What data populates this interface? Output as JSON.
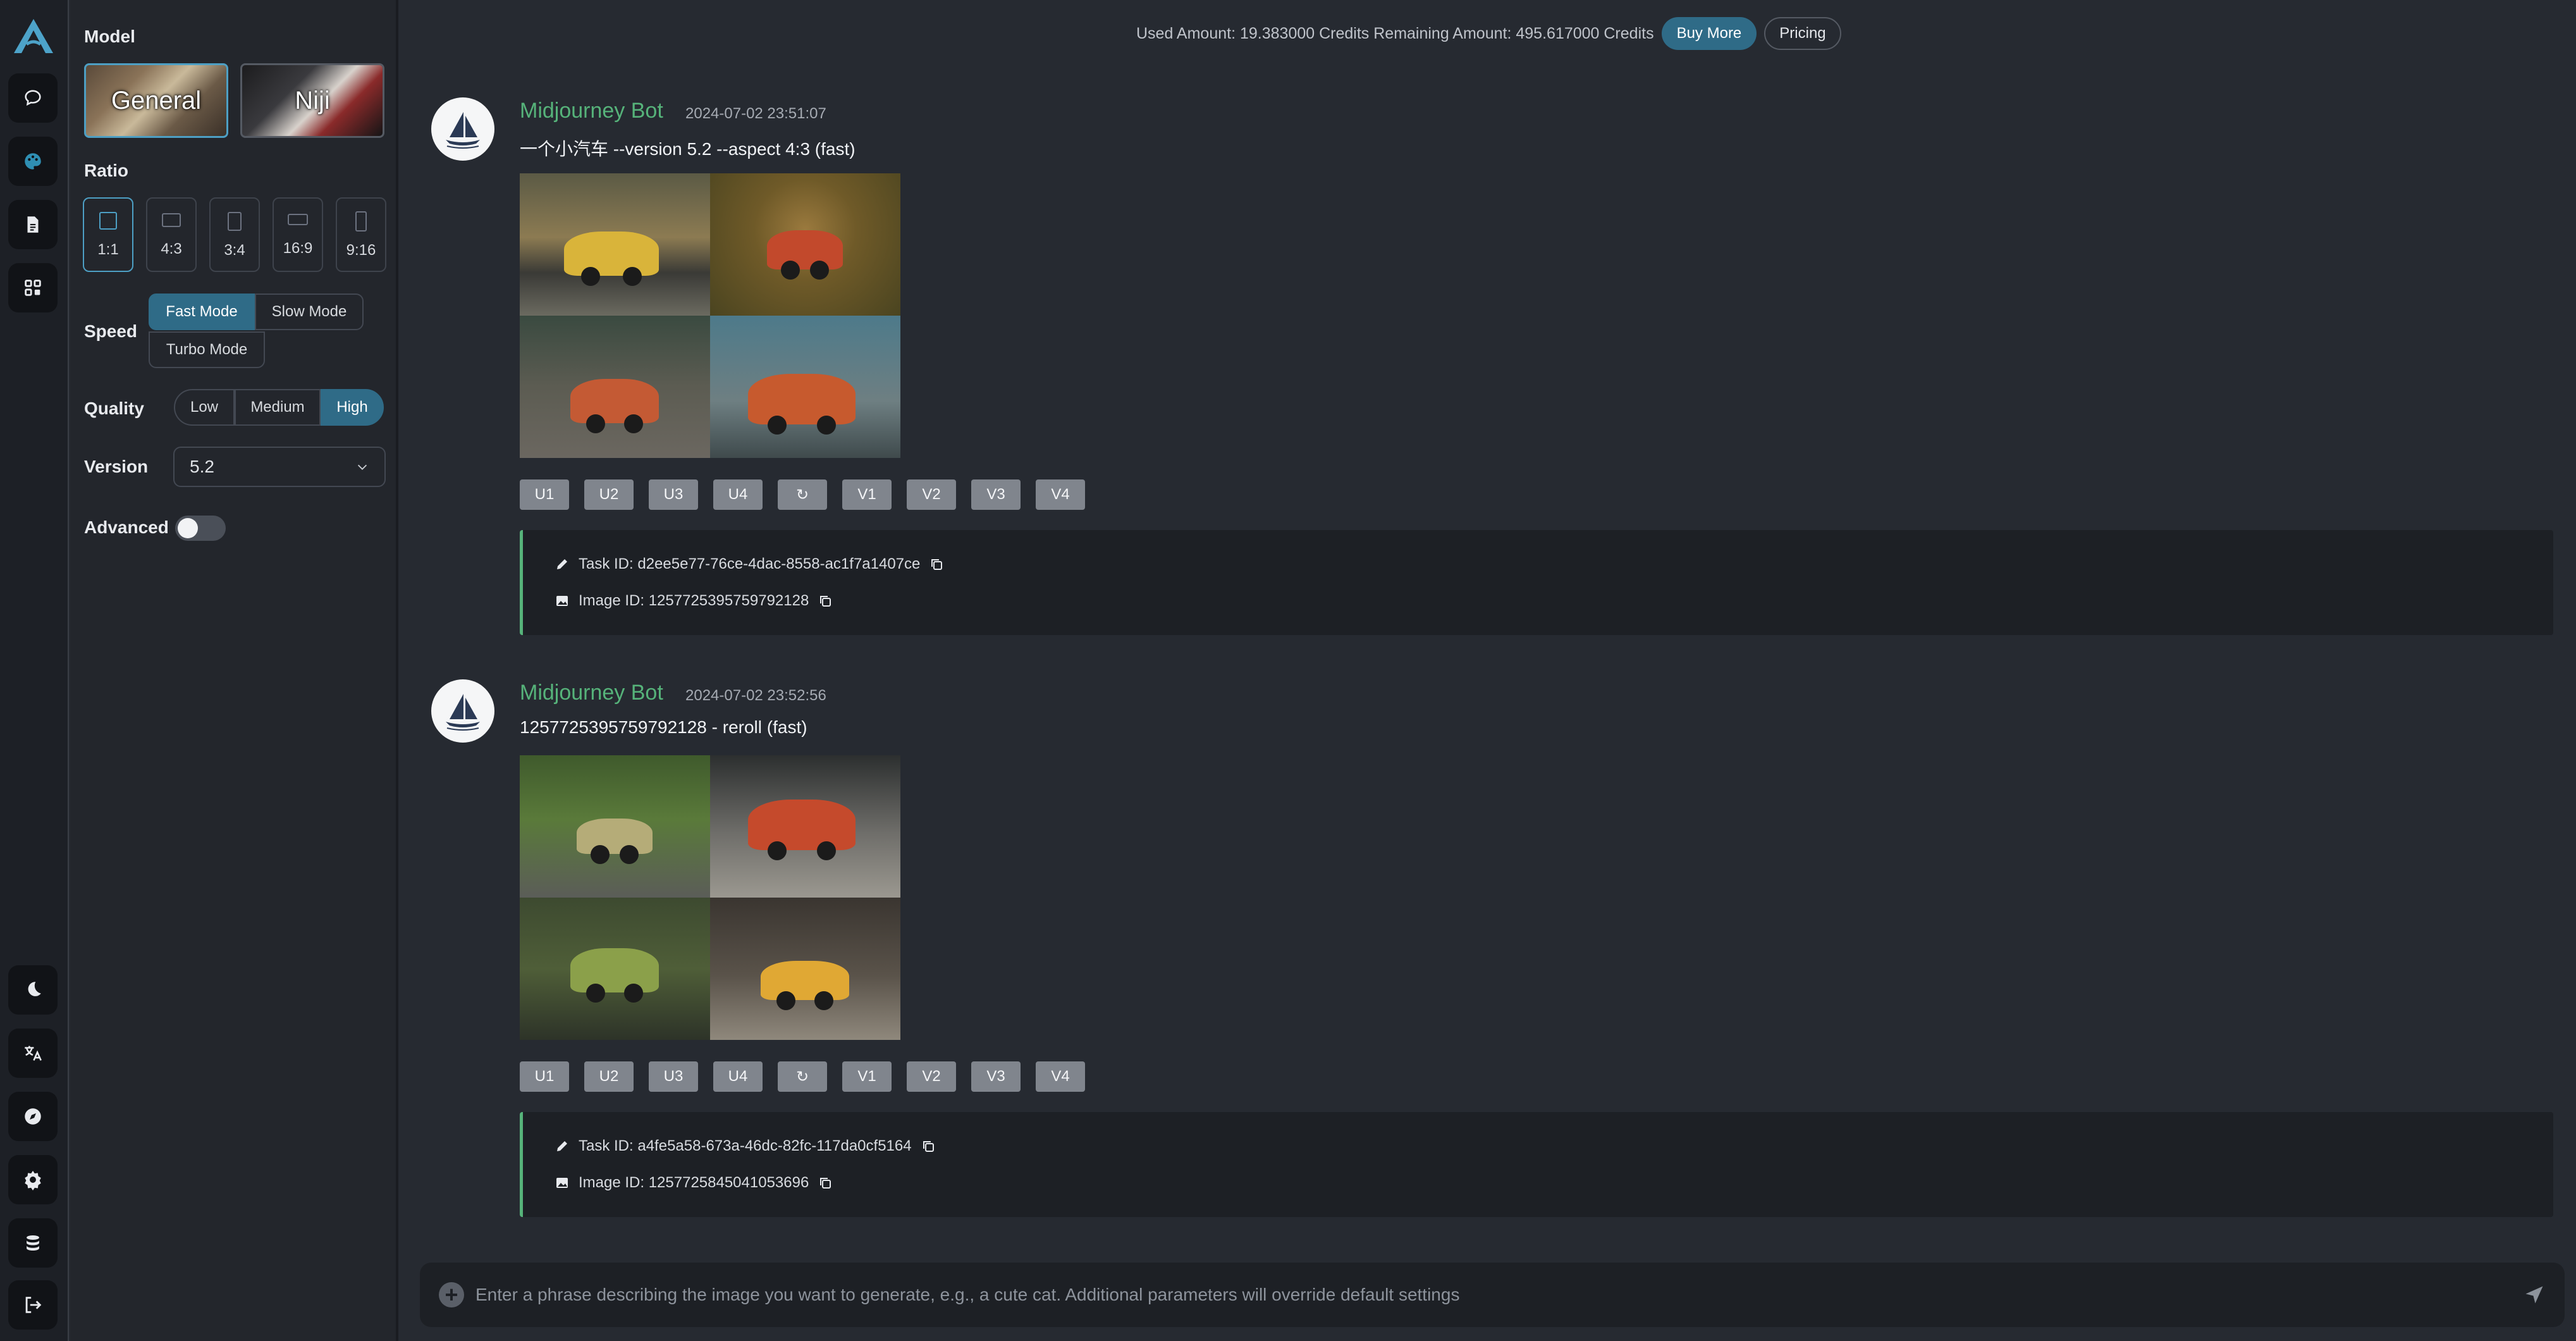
{
  "colors": {
    "accent": "#2f6b87",
    "bot_name": "#56b37a",
    "background": "#262a31"
  },
  "rail": {
    "top_icons": [
      "chat-icon",
      "palette-icon",
      "document-icon",
      "apps-icon"
    ],
    "bottom_icons": [
      "moon-icon",
      "translate-icon",
      "compass-icon",
      "gear-icon",
      "coins-icon",
      "logout-icon"
    ]
  },
  "settings": {
    "model_label": "Model",
    "models": [
      "General",
      "Niji"
    ],
    "ratio_label": "Ratio",
    "ratios": [
      "1:1",
      "4:3",
      "3:4",
      "16:9",
      "9:16"
    ],
    "speed_label": "Speed",
    "speeds": [
      "Fast Mode",
      "Slow Mode",
      "Turbo Mode"
    ],
    "quality_label": "Quality",
    "qualities": [
      "Low",
      "Medium",
      "High"
    ],
    "version_label": "Version",
    "version_value": "5.2",
    "advanced_label": "Advanced"
  },
  "topbar": {
    "usage": "Used Amount: 19.383000 Credits Remaining Amount: 495.617000 Credits",
    "buy_more": "Buy More",
    "pricing": "Pricing"
  },
  "messages": [
    {
      "bot_name": "Midjourney Bot",
      "time": "2024-07-02 23:51:07",
      "prompt": "一个小汽车 --version 5.2 --aspect 4:3 (fast)",
      "task_id": "Task ID: d2ee5e77-76ce-4dac-8558-ac1f7a1407ce",
      "image_id": "Image ID: 1257725395759792128"
    },
    {
      "bot_name": "Midjourney Bot",
      "time": "2024-07-02 23:52:56",
      "prompt": "1257725395759792128 - reroll (fast)",
      "task_id": "Task ID: a4fe5a58-673a-46dc-82fc-117da0cf5164",
      "image_id": "Image ID: 1257725845041053696"
    }
  ],
  "action_buttons": [
    "U1",
    "U2",
    "U3",
    "U4",
    "↻",
    "V1",
    "V2",
    "V3",
    "V4"
  ],
  "composer": {
    "placeholder": "Enter a phrase describing the image you want to generate, e.g., a cute cat. Additional parameters will override default settings"
  }
}
